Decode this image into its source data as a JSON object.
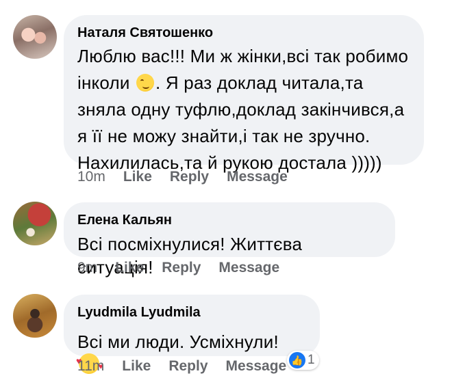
{
  "comments": [
    {
      "author": "Наталя Святошенко",
      "text_before_emoji": "Люблю вас!!! Ми ж жінки,всі так робимо інколи",
      "emoji": "winking-face-icon",
      "text_after_emoji": ". Я раз доклад читала,та зняла одну туфлю,доклад закінчився,а я її не можу знайти,і так не зручно. Нахилилась,та й рукою достала )))))",
      "time": "10m",
      "like": "Like",
      "reply": "Reply",
      "message": "Message"
    },
    {
      "author": "Елена Кальян",
      "text": "Всі посміхнулися! Життєва ситуація!",
      "time": "9m",
      "like": "Like",
      "reply": "Reply",
      "message": "Message"
    },
    {
      "author": "Lyudmila Lyudmila",
      "text": "Всі ми люди. Усміхнули!",
      "emoji": "smiling-face-with-hearts-icon",
      "time": "11m",
      "like": "Like",
      "reply": "Reply",
      "message": "Message",
      "reaction_count": "1",
      "reaction_icon": "thumbs-up-icon"
    }
  ],
  "colors": {
    "bubble": "#f0f2f5",
    "meta_text": "#65676b",
    "like_blue": "#1877f2"
  }
}
